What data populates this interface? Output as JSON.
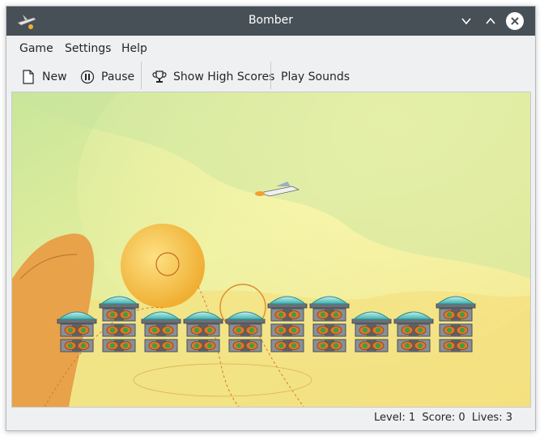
{
  "window": {
    "title": "Bomber",
    "app_icon": "bomber-plane-icon"
  },
  "window_controls": {
    "minimize_icon": "chevron-down-icon",
    "maximize_icon": "chevron-up-icon",
    "close_icon": "close-icon"
  },
  "menubar": {
    "items": [
      {
        "label": "Game"
      },
      {
        "label": "Settings"
      },
      {
        "label": "Help"
      }
    ]
  },
  "toolbar": {
    "new": {
      "label": "New",
      "icon": "document-new-icon"
    },
    "pause": {
      "label": "Pause",
      "icon": "pause-icon"
    },
    "high_scores": {
      "label": "Show High Scores",
      "icon": "trophy-icon"
    },
    "sounds": {
      "label": "Play Sounds"
    }
  },
  "game": {
    "buildings": [
      2,
      3,
      2,
      2,
      2,
      3,
      3,
      2,
      2,
      3
    ]
  },
  "status": {
    "level": "Level: 1",
    "score": "Score: 0",
    "lives": "Lives: 3"
  }
}
